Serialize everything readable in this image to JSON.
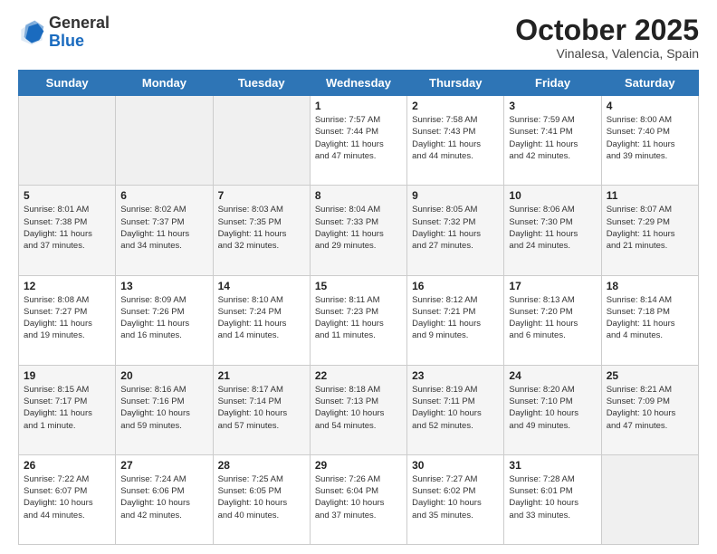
{
  "header": {
    "logo_general": "General",
    "logo_blue": "Blue",
    "month": "October 2025",
    "location": "Vinalesa, Valencia, Spain"
  },
  "weekdays": [
    "Sunday",
    "Monday",
    "Tuesday",
    "Wednesday",
    "Thursday",
    "Friday",
    "Saturday"
  ],
  "weeks": [
    [
      {
        "day": "",
        "info": ""
      },
      {
        "day": "",
        "info": ""
      },
      {
        "day": "",
        "info": ""
      },
      {
        "day": "1",
        "info": "Sunrise: 7:57 AM\nSunset: 7:44 PM\nDaylight: 11 hours\nand 47 minutes."
      },
      {
        "day": "2",
        "info": "Sunrise: 7:58 AM\nSunset: 7:43 PM\nDaylight: 11 hours\nand 44 minutes."
      },
      {
        "day": "3",
        "info": "Sunrise: 7:59 AM\nSunset: 7:41 PM\nDaylight: 11 hours\nand 42 minutes."
      },
      {
        "day": "4",
        "info": "Sunrise: 8:00 AM\nSunset: 7:40 PM\nDaylight: 11 hours\nand 39 minutes."
      }
    ],
    [
      {
        "day": "5",
        "info": "Sunrise: 8:01 AM\nSunset: 7:38 PM\nDaylight: 11 hours\nand 37 minutes."
      },
      {
        "day": "6",
        "info": "Sunrise: 8:02 AM\nSunset: 7:37 PM\nDaylight: 11 hours\nand 34 minutes."
      },
      {
        "day": "7",
        "info": "Sunrise: 8:03 AM\nSunset: 7:35 PM\nDaylight: 11 hours\nand 32 minutes."
      },
      {
        "day": "8",
        "info": "Sunrise: 8:04 AM\nSunset: 7:33 PM\nDaylight: 11 hours\nand 29 minutes."
      },
      {
        "day": "9",
        "info": "Sunrise: 8:05 AM\nSunset: 7:32 PM\nDaylight: 11 hours\nand 27 minutes."
      },
      {
        "day": "10",
        "info": "Sunrise: 8:06 AM\nSunset: 7:30 PM\nDaylight: 11 hours\nand 24 minutes."
      },
      {
        "day": "11",
        "info": "Sunrise: 8:07 AM\nSunset: 7:29 PM\nDaylight: 11 hours\nand 21 minutes."
      }
    ],
    [
      {
        "day": "12",
        "info": "Sunrise: 8:08 AM\nSunset: 7:27 PM\nDaylight: 11 hours\nand 19 minutes."
      },
      {
        "day": "13",
        "info": "Sunrise: 8:09 AM\nSunset: 7:26 PM\nDaylight: 11 hours\nand 16 minutes."
      },
      {
        "day": "14",
        "info": "Sunrise: 8:10 AM\nSunset: 7:24 PM\nDaylight: 11 hours\nand 14 minutes."
      },
      {
        "day": "15",
        "info": "Sunrise: 8:11 AM\nSunset: 7:23 PM\nDaylight: 11 hours\nand 11 minutes."
      },
      {
        "day": "16",
        "info": "Sunrise: 8:12 AM\nSunset: 7:21 PM\nDaylight: 11 hours\nand 9 minutes."
      },
      {
        "day": "17",
        "info": "Sunrise: 8:13 AM\nSunset: 7:20 PM\nDaylight: 11 hours\nand 6 minutes."
      },
      {
        "day": "18",
        "info": "Sunrise: 8:14 AM\nSunset: 7:18 PM\nDaylight: 11 hours\nand 4 minutes."
      }
    ],
    [
      {
        "day": "19",
        "info": "Sunrise: 8:15 AM\nSunset: 7:17 PM\nDaylight: 11 hours\nand 1 minute."
      },
      {
        "day": "20",
        "info": "Sunrise: 8:16 AM\nSunset: 7:16 PM\nDaylight: 10 hours\nand 59 minutes."
      },
      {
        "day": "21",
        "info": "Sunrise: 8:17 AM\nSunset: 7:14 PM\nDaylight: 10 hours\nand 57 minutes."
      },
      {
        "day": "22",
        "info": "Sunrise: 8:18 AM\nSunset: 7:13 PM\nDaylight: 10 hours\nand 54 minutes."
      },
      {
        "day": "23",
        "info": "Sunrise: 8:19 AM\nSunset: 7:11 PM\nDaylight: 10 hours\nand 52 minutes."
      },
      {
        "day": "24",
        "info": "Sunrise: 8:20 AM\nSunset: 7:10 PM\nDaylight: 10 hours\nand 49 minutes."
      },
      {
        "day": "25",
        "info": "Sunrise: 8:21 AM\nSunset: 7:09 PM\nDaylight: 10 hours\nand 47 minutes."
      }
    ],
    [
      {
        "day": "26",
        "info": "Sunrise: 7:22 AM\nSunset: 6:07 PM\nDaylight: 10 hours\nand 44 minutes."
      },
      {
        "day": "27",
        "info": "Sunrise: 7:24 AM\nSunset: 6:06 PM\nDaylight: 10 hours\nand 42 minutes."
      },
      {
        "day": "28",
        "info": "Sunrise: 7:25 AM\nSunset: 6:05 PM\nDaylight: 10 hours\nand 40 minutes."
      },
      {
        "day": "29",
        "info": "Sunrise: 7:26 AM\nSunset: 6:04 PM\nDaylight: 10 hours\nand 37 minutes."
      },
      {
        "day": "30",
        "info": "Sunrise: 7:27 AM\nSunset: 6:02 PM\nDaylight: 10 hours\nand 35 minutes."
      },
      {
        "day": "31",
        "info": "Sunrise: 7:28 AM\nSunset: 6:01 PM\nDaylight: 10 hours\nand 33 minutes."
      },
      {
        "day": "",
        "info": ""
      }
    ]
  ]
}
